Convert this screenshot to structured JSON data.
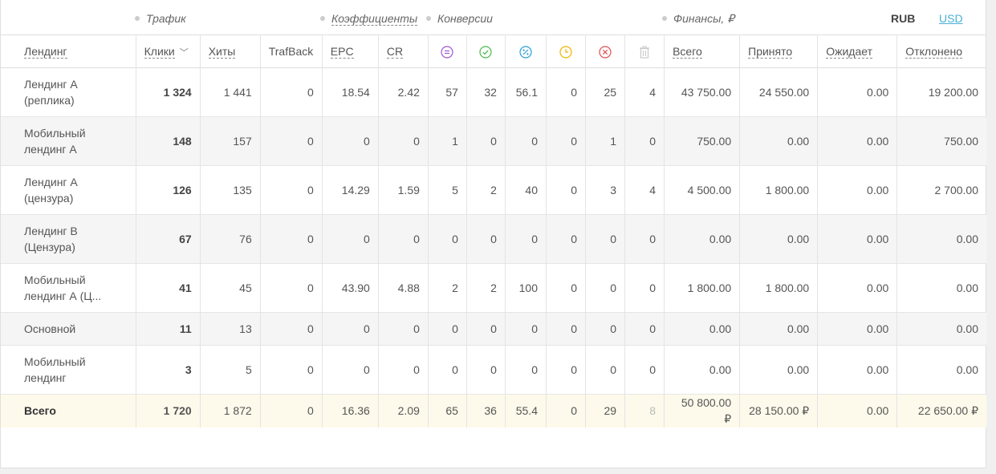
{
  "groups": {
    "traffic": "Трафик",
    "coefficients": "Коэффициенты",
    "conversions": "Конверсии",
    "finance": "Финансы, ₽"
  },
  "currency": {
    "rub": "RUB",
    "usd": "USD"
  },
  "columns": {
    "landing": "Лендинг",
    "clicks": "Клики",
    "hits": "Хиты",
    "trafback": "TrafBack",
    "epc": "EPC",
    "cr": "CR",
    "total": "Всего",
    "accepted": "Принято",
    "pending": "Ожидает",
    "rejected": "Отклонено"
  },
  "status_icons": {
    "all": {
      "icon": "equals-circle-icon",
      "color": "#9b59d0"
    },
    "approved": {
      "icon": "check-circle-icon",
      "color": "#4cbb4c"
    },
    "percent": {
      "icon": "percent-circle-icon",
      "color": "#2a9fd6"
    },
    "pending": {
      "icon": "clock-circle-icon",
      "color": "#f0b400"
    },
    "rejected": {
      "icon": "x-circle-icon",
      "color": "#e05050"
    },
    "trash": {
      "icon": "trash-icon",
      "color": "#c8c8c8"
    }
  },
  "rows": [
    {
      "name": "Лендинг А (реплика)",
      "clicks": "1 324",
      "hits": "1 441",
      "trafback": "0",
      "epc": "18.54",
      "cr": "2.42",
      "c_all": "57",
      "c_ok": "32",
      "c_pct": "56.1",
      "c_wait": "0",
      "c_rej": "25",
      "c_trash": "4",
      "f_total": "43 750.00",
      "f_acc": "24 550.00",
      "f_pend": "0.00",
      "f_rej": "19 200.00"
    },
    {
      "name": "Мобильный лендинг А",
      "clicks": "148",
      "hits": "157",
      "trafback": "0",
      "epc": "0",
      "cr": "0",
      "c_all": "1",
      "c_ok": "0",
      "c_pct": "0",
      "c_wait": "0",
      "c_rej": "1",
      "c_trash": "0",
      "f_total": "750.00",
      "f_acc": "0.00",
      "f_pend": "0.00",
      "f_rej": "750.00"
    },
    {
      "name": "Лендинг А (цензура)",
      "clicks": "126",
      "hits": "135",
      "trafback": "0",
      "epc": "14.29",
      "cr": "1.59",
      "c_all": "5",
      "c_ok": "2",
      "c_pct": "40",
      "c_wait": "0",
      "c_rej": "3",
      "c_trash": "4",
      "f_total": "4 500.00",
      "f_acc": "1 800.00",
      "f_pend": "0.00",
      "f_rej": "2 700.00"
    },
    {
      "name": "Лендинг B (Цензура)",
      "clicks": "67",
      "hits": "76",
      "trafback": "0",
      "epc": "0",
      "cr": "0",
      "c_all": "0",
      "c_ok": "0",
      "c_pct": "0",
      "c_wait": "0",
      "c_rej": "0",
      "c_trash": "0",
      "f_total": "0.00",
      "f_acc": "0.00",
      "f_pend": "0.00",
      "f_rej": "0.00"
    },
    {
      "name": "Мобильный лендинг А (Ц...",
      "clicks": "41",
      "hits": "45",
      "trafback": "0",
      "epc": "43.90",
      "cr": "4.88",
      "c_all": "2",
      "c_ok": "2",
      "c_pct": "100",
      "c_wait": "0",
      "c_rej": "0",
      "c_trash": "0",
      "f_total": "1 800.00",
      "f_acc": "1 800.00",
      "f_pend": "0.00",
      "f_rej": "0.00"
    },
    {
      "name": "Основной",
      "clicks": "11",
      "hits": "13",
      "trafback": "0",
      "epc": "0",
      "cr": "0",
      "c_all": "0",
      "c_ok": "0",
      "c_pct": "0",
      "c_wait": "0",
      "c_rej": "0",
      "c_trash": "0",
      "f_total": "0.00",
      "f_acc": "0.00",
      "f_pend": "0.00",
      "f_rej": "0.00"
    },
    {
      "name": "Мобильный лендинг",
      "clicks": "3",
      "hits": "5",
      "trafback": "0",
      "epc": "0",
      "cr": "0",
      "c_all": "0",
      "c_ok": "0",
      "c_pct": "0",
      "c_wait": "0",
      "c_rej": "0",
      "c_trash": "0",
      "f_total": "0.00",
      "f_acc": "0.00",
      "f_pend": "0.00",
      "f_rej": "0.00"
    }
  ],
  "totals": {
    "name": "Всего",
    "clicks": "1 720",
    "hits": "1 872",
    "trafback": "0",
    "epc": "16.36",
    "cr": "2.09",
    "c_all": "65",
    "c_ok": "36",
    "c_pct": "55.4",
    "c_wait": "0",
    "c_rej": "29",
    "c_trash": "8",
    "f_total": "50 800.00 ₽",
    "f_acc": "28 150.00 ₽",
    "f_pend": "0.00",
    "f_rej": "22 650.00 ₽"
  }
}
